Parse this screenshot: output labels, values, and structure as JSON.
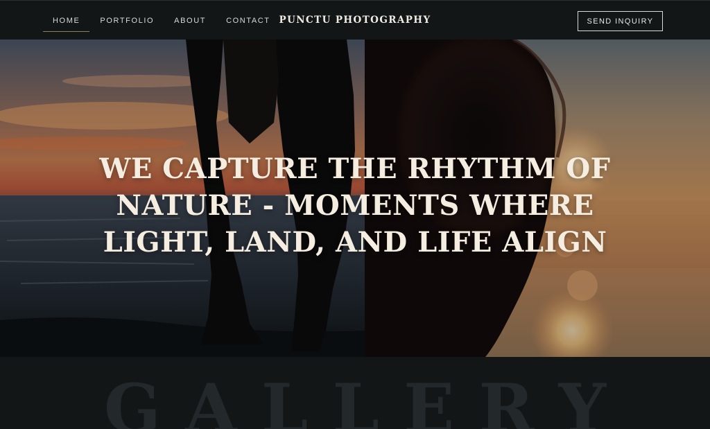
{
  "nav": {
    "items": [
      {
        "label": "HOME",
        "active": true
      },
      {
        "label": "PORTFOLIO",
        "active": false
      },
      {
        "label": "ABOUT",
        "active": false
      },
      {
        "label": "CONTACT",
        "active": false
      }
    ]
  },
  "brand": {
    "name": "PUNCTU PHOTOGRAPHY"
  },
  "header": {
    "cta_label": "SEND INQUIRY"
  },
  "hero": {
    "title": "WE CAPTURE THE RHYTHM OF NATURE - MOMENTS WHERE LIGHT, LAND, AND LIFE ALIGN"
  },
  "gallery": {
    "heading": "GALLERY"
  },
  "colors": {
    "background": "#121617",
    "hero_text": "#f6ede1",
    "active_underline": "#8e8062",
    "gallery_text": "#23292b"
  }
}
